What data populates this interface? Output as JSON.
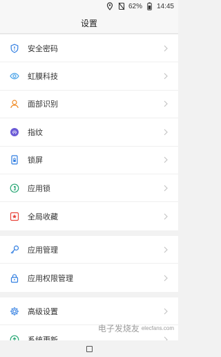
{
  "status_bar": {
    "battery": "62%",
    "time": "14:45",
    "icons": [
      "location-icon",
      "no-sim-icon",
      "battery-icon"
    ]
  },
  "header": {
    "title": "设置"
  },
  "sections": [
    {
      "items": [
        {
          "label": "安全密码",
          "icon": "shield-icon",
          "color": "#2f7de1"
        },
        {
          "label": "虹膜科技",
          "icon": "eye-icon",
          "color": "#4aa3e8"
        },
        {
          "label": "面部识别",
          "icon": "face-icon",
          "color": "#f08a24"
        },
        {
          "label": "指纹",
          "icon": "fingerprint-icon",
          "color": "#6b5bd6"
        },
        {
          "label": "锁屏",
          "icon": "lockscreen-icon",
          "color": "#2f7de1"
        },
        {
          "label": "应用锁",
          "icon": "app-lock-icon",
          "color": "#2aa876"
        },
        {
          "label": "全局收藏",
          "icon": "star-icon",
          "color": "#e8453c"
        }
      ]
    },
    {
      "items": [
        {
          "label": "应用管理",
          "icon": "key-icon",
          "color": "#2f7de1"
        },
        {
          "label": "应用权限管理",
          "icon": "padlock-icon",
          "color": "#2f7de1"
        }
      ]
    },
    {
      "items": [
        {
          "label": "高级设置",
          "icon": "gear-icon",
          "color": "#2f7de1"
        },
        {
          "label": "系统更新",
          "icon": "update-icon",
          "color": "#2aa876"
        }
      ]
    }
  ],
  "watermark": {
    "text": "电子发烧友",
    "sub": "elecfans.com"
  },
  "colors": {
    "chevron": "#c4c4c4",
    "divider": "#efefef",
    "background": "#f2f2f2"
  }
}
